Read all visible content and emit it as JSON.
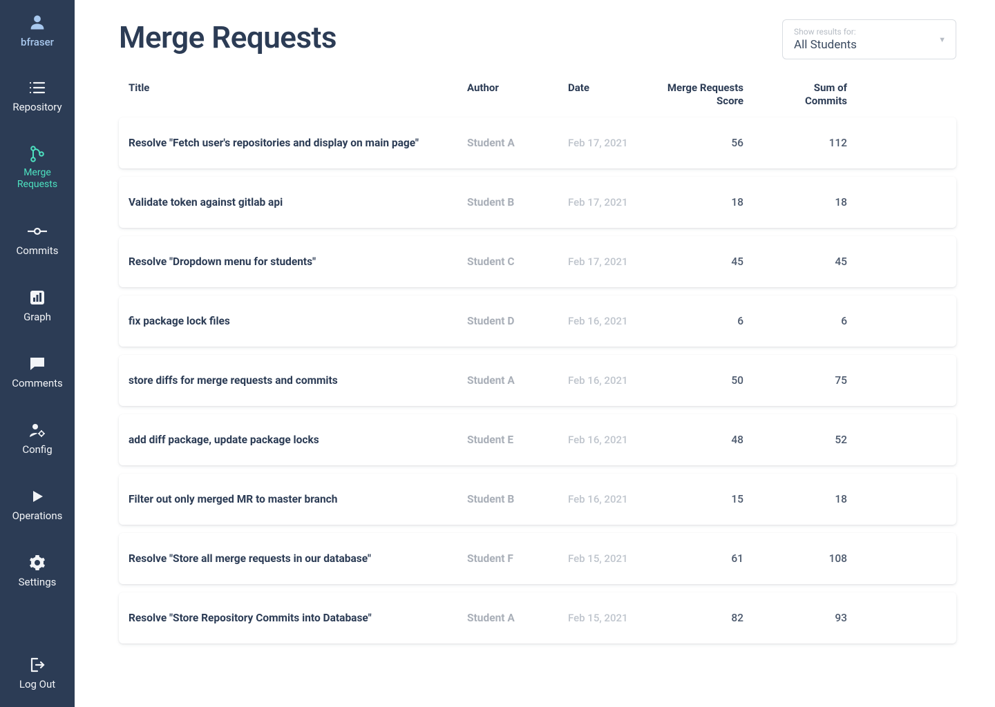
{
  "user": {
    "name": "bfraser"
  },
  "sidebar": {
    "items": [
      {
        "label_line1": "Repository"
      },
      {
        "label_line1": "Merge",
        "label_line2": "Requests"
      },
      {
        "label_line1": "Commits"
      },
      {
        "label_line1": "Graph"
      },
      {
        "label_line1": "Comments"
      },
      {
        "label_line1": "Config"
      },
      {
        "label_line1": "Operations"
      },
      {
        "label_line1": "Settings"
      }
    ],
    "logout": "Log Out"
  },
  "page": {
    "title": "Merge Requests",
    "filter_label": "Show results for:",
    "filter_value": "All Students"
  },
  "table": {
    "headers": {
      "title": "Title",
      "author": "Author",
      "date": "Date",
      "score_line1": "Merge Requests",
      "score_line2": "Score",
      "sum_line1": "Sum of",
      "sum_line2": "Commits"
    },
    "rows": [
      {
        "title": "Resolve \"Fetch user's repositories and display on main page\"",
        "author": "Student A",
        "date": "Feb 17, 2021",
        "score": "56",
        "sum": "112"
      },
      {
        "title": "Validate token against gitlab api",
        "author": "Student B",
        "date": "Feb 17, 2021",
        "score": "18",
        "sum": "18"
      },
      {
        "title": "Resolve \"Dropdown menu for students\"",
        "author": "Student C",
        "date": "Feb 17, 2021",
        "score": "45",
        "sum": "45"
      },
      {
        "title": "fix package lock files",
        "author": "Student D",
        "date": "Feb 16, 2021",
        "score": "6",
        "sum": "6"
      },
      {
        "title": "store diffs for merge requests and commits",
        "author": "Student A",
        "date": "Feb 16, 2021",
        "score": "50",
        "sum": "75"
      },
      {
        "title": "add diff package, update package locks",
        "author": "Student E",
        "date": "Feb 16, 2021",
        "score": "48",
        "sum": "52"
      },
      {
        "title": "Filter out only merged MR to master branch",
        "author": "Student B",
        "date": "Feb 16, 2021",
        "score": "15",
        "sum": "18"
      },
      {
        "title": "Resolve \"Store all merge requests in our database\"",
        "author": "Student F",
        "date": "Feb 15, 2021",
        "score": "61",
        "sum": "108"
      },
      {
        "title": "Resolve \"Store Repository Commits into Database\"",
        "author": "Student A",
        "date": "Feb 15, 2021",
        "score": "82",
        "sum": "93"
      }
    ]
  }
}
